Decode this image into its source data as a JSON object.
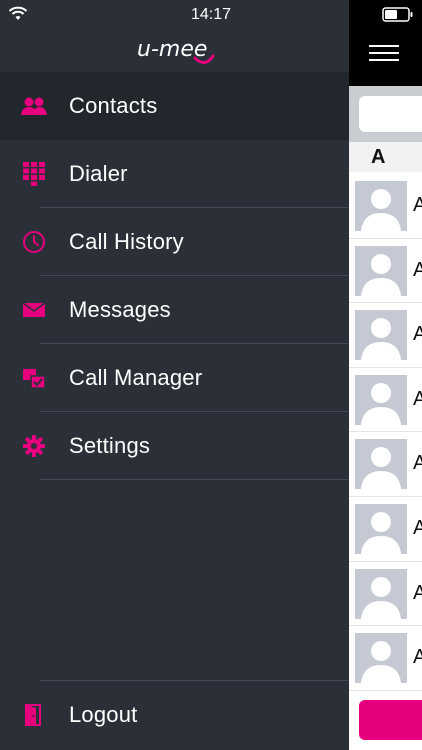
{
  "status_bar": {
    "time": "14:17",
    "wifi_icon": "wifi-icon",
    "battery_icon": "battery-icon"
  },
  "app": {
    "logo_text": "u-mee",
    "accent_color": "#e6007e"
  },
  "menu": {
    "items": [
      {
        "label": "Contacts",
        "icon": "contacts-icon",
        "active": true
      },
      {
        "label": "Dialer",
        "icon": "dialpad-icon",
        "active": false
      },
      {
        "label": "Call History",
        "icon": "clock-icon",
        "active": false
      },
      {
        "label": "Messages",
        "icon": "envelope-icon",
        "active": false
      },
      {
        "label": "Call Manager",
        "icon": "call-manager-icon",
        "active": false
      },
      {
        "label": "Settings",
        "icon": "gear-icon",
        "active": false
      }
    ],
    "logout": {
      "label": "Logout",
      "icon": "logout-door-icon"
    }
  },
  "peek": {
    "section_letter": "A",
    "contact_initials": [
      "A",
      "A",
      "A",
      "A",
      "A",
      "A",
      "A",
      "A"
    ]
  }
}
